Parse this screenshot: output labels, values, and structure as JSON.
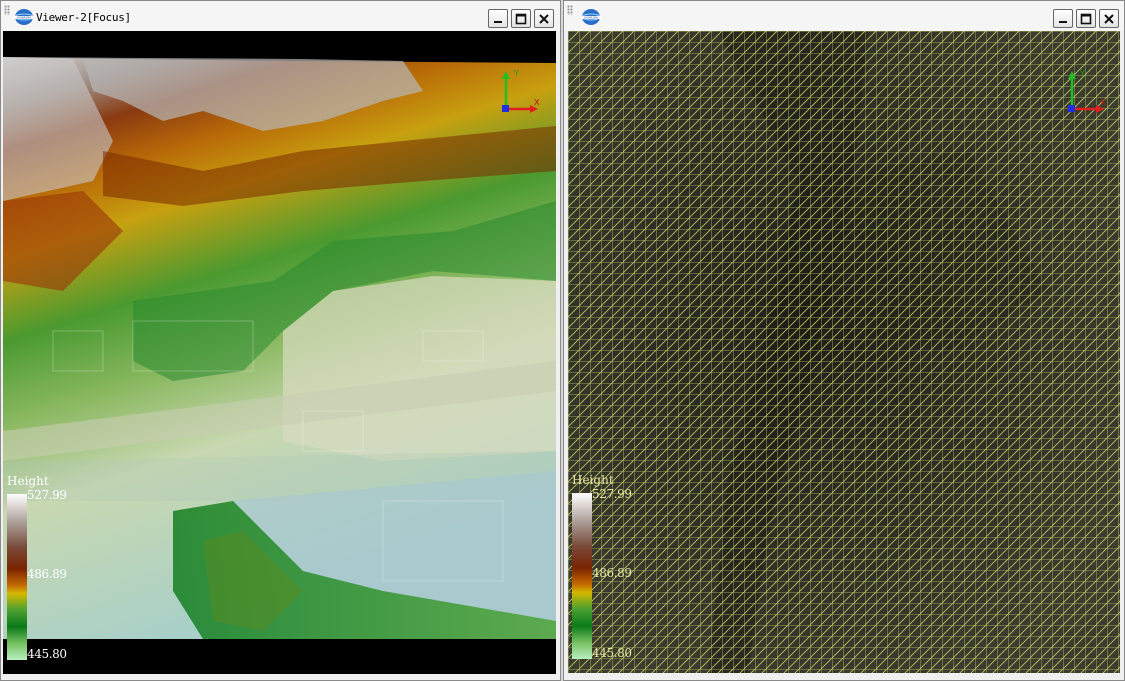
{
  "viewer_left": {
    "title": "Viewer-2[Focus]",
    "legend": {
      "title": "Height",
      "max": "527.99",
      "mid": "486.89",
      "min": "445.80"
    },
    "axis": {
      "x": "X",
      "y": "Y"
    }
  },
  "viewer_right": {
    "title": "",
    "legend": {
      "title": "Height",
      "max": "527.99",
      "mid": "486.89",
      "min": "445.80"
    },
    "axis": {
      "x": "X",
      "y": "Y"
    }
  },
  "colors": {
    "mesh_lines": "#d8e070",
    "legend_text_left": "#ffffff",
    "legend_text_right": "#e6e8a0"
  },
  "icons": [
    "app-logo",
    "minimize-icon",
    "maximize-icon",
    "close-icon",
    "axis-gizmo"
  ]
}
